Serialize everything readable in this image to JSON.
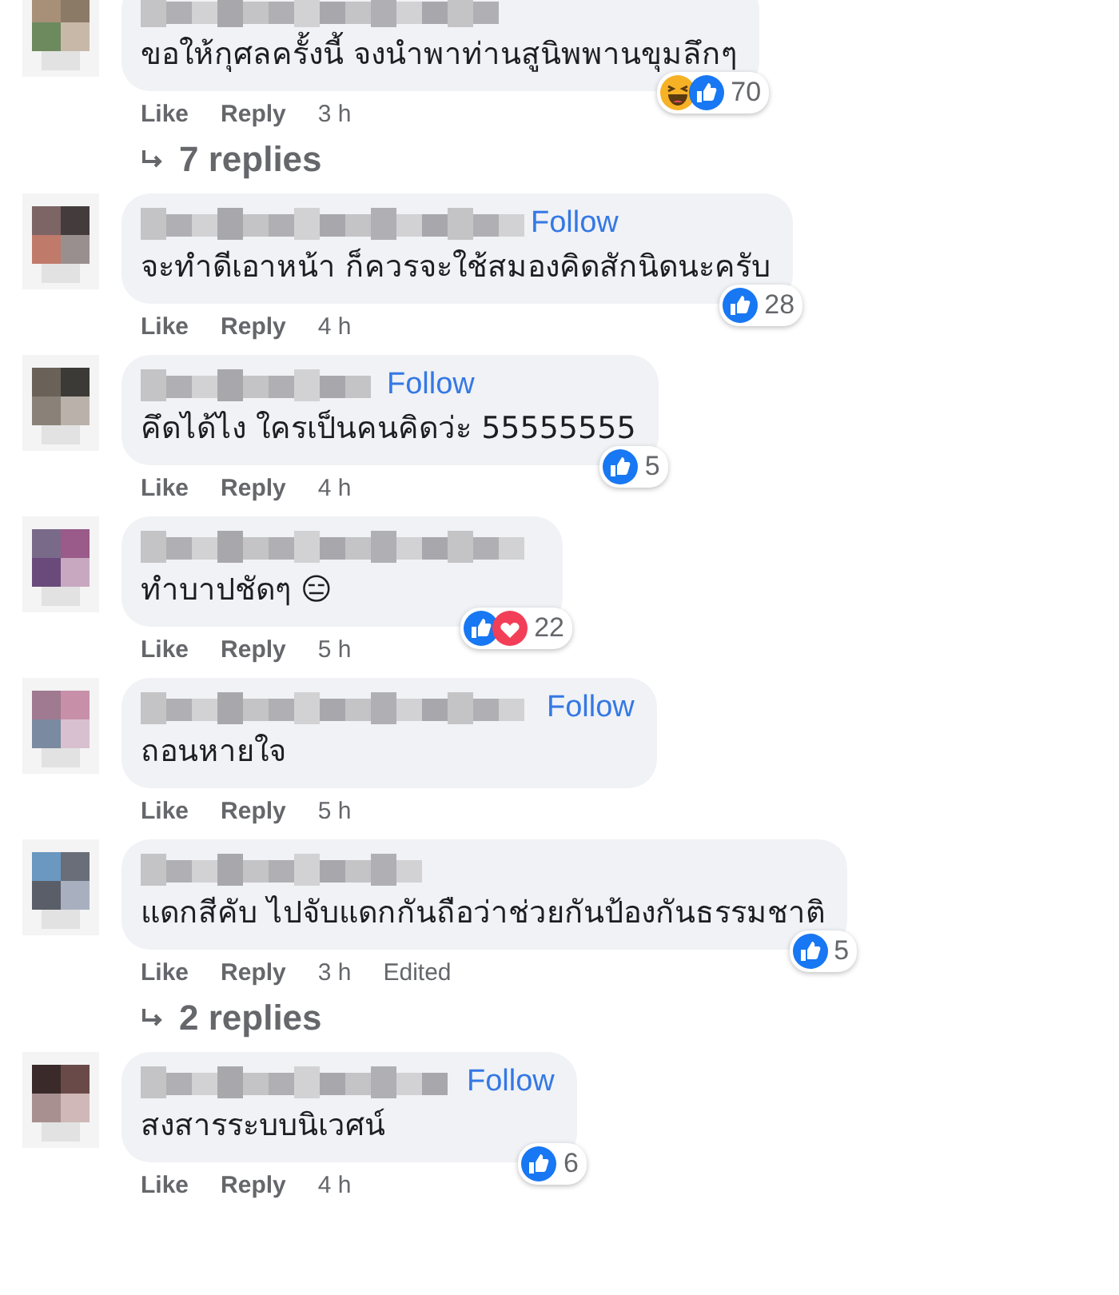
{
  "comments": [
    {
      "text": "ขอให้กุศลครั้งนี้ จงนำพาท่านสูนิพพานขุมลึกๆ",
      "reactions": [
        {
          "kind": "haha"
        },
        {
          "kind": "like"
        }
      ],
      "count": "70",
      "actions": [
        "Like",
        "Reply"
      ],
      "time": "3 h",
      "replies": "7 replies"
    },
    {
      "text": "จะทำดีเอาหน้า ก็ควรจะใช้สมองคิดสักนิดนะครับ",
      "follow": "Follow",
      "reactions": [
        {
          "kind": "like"
        }
      ],
      "count": "28",
      "actions": [
        "Like",
        "Reply"
      ],
      "time": "4 h"
    },
    {
      "text": "คึดได้ไง ใครเป็นคนคิดว่ะ 55555555",
      "follow": "Follow",
      "reactions": [
        {
          "kind": "like"
        }
      ],
      "count": "5",
      "actions": [
        "Like",
        "Reply"
      ],
      "time": "4 h"
    },
    {
      "text": "ทำบาปชัดๆ 😑",
      "reactions": [
        {
          "kind": "like"
        },
        {
          "kind": "love"
        }
      ],
      "count": "22",
      "actions": [
        "Like",
        "Reply"
      ],
      "time": "5 h"
    },
    {
      "text": "ถอนหายใจ",
      "follow": "Follow",
      "actions": [
        "Like",
        "Reply"
      ],
      "time": "5 h"
    },
    {
      "text": "แดกสีคับ ไปจับแดกกันถือว่าช่วยกันป้องกันธรรมชาติ",
      "reactions": [
        {
          "kind": "like"
        }
      ],
      "count": "5",
      "actions": [
        "Like",
        "Reply"
      ],
      "time": "3 h",
      "edited": "Edited",
      "replies": "2 replies"
    },
    {
      "text": "สงสารระบบนิเวศน์",
      "follow": "Follow",
      "reactions": [
        {
          "kind": "like"
        }
      ],
      "count": "6",
      "actions": [
        "Like",
        "Reply"
      ],
      "time": "4 h"
    }
  ]
}
